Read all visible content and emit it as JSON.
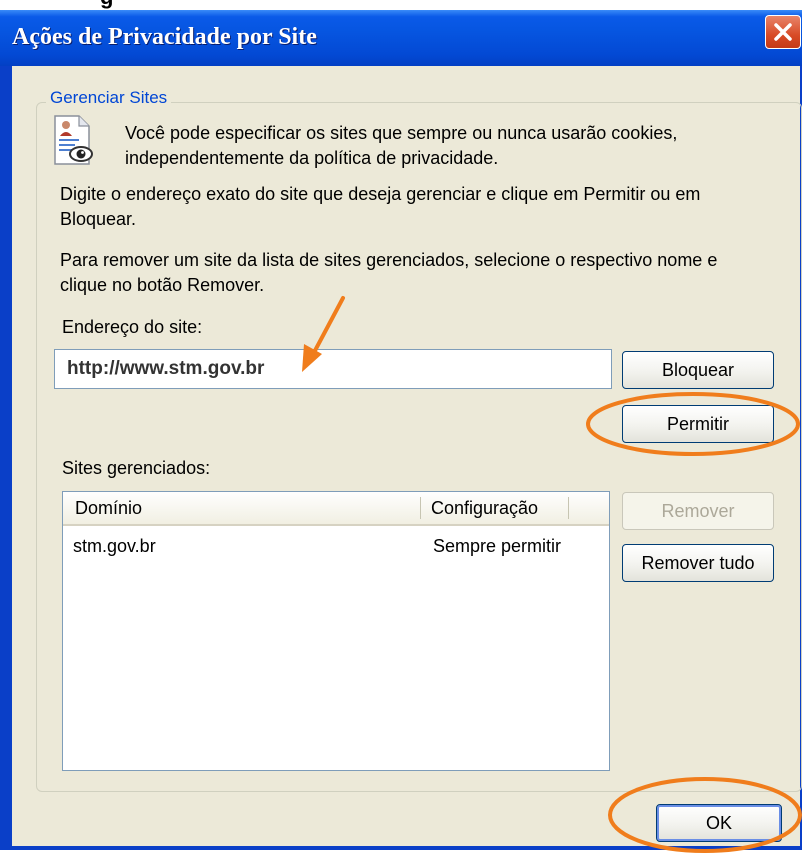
{
  "window": {
    "title": "Ações de Privacidade por Site",
    "close_label": "Fechar"
  },
  "group": {
    "label": "Gerenciar Sites",
    "intro_line1": "Você pode especificar os sites que sempre ou nunca usarão cookies,",
    "intro_line2": "independentemente da política de privacidade.",
    "instructions1_line1": "Digite o endereço exato do site que deseja gerenciar e clique em Permitir ou em",
    "instructions1_line2": "Bloquear.",
    "instructions2_line1": "Para remover um site da lista de sites gerenciados, selecione o respectivo nome e",
    "instructions2_line2": "clique no botão Remover."
  },
  "address": {
    "label": "Endereço do site:",
    "value": "http://www.stm.gov.br"
  },
  "buttons": {
    "block": "Bloquear",
    "allow": "Permitir",
    "remove": "Remover",
    "remove_all": "Remover tudo",
    "ok": "OK"
  },
  "managed": {
    "label": "Sites gerenciados:",
    "columns": [
      "Domínio",
      "Configuração"
    ],
    "rows": [
      {
        "domain": "stm.gov.br",
        "setting": "Sempre permitir"
      }
    ]
  },
  "icons": {
    "title_close": "close-icon",
    "privacy": "privacy-document-icon"
  },
  "colors": {
    "titlebar": "#0655e0",
    "dialog_bg": "#ece9d8",
    "group_label": "#0046d5",
    "annotation": "#f07d1c"
  }
}
